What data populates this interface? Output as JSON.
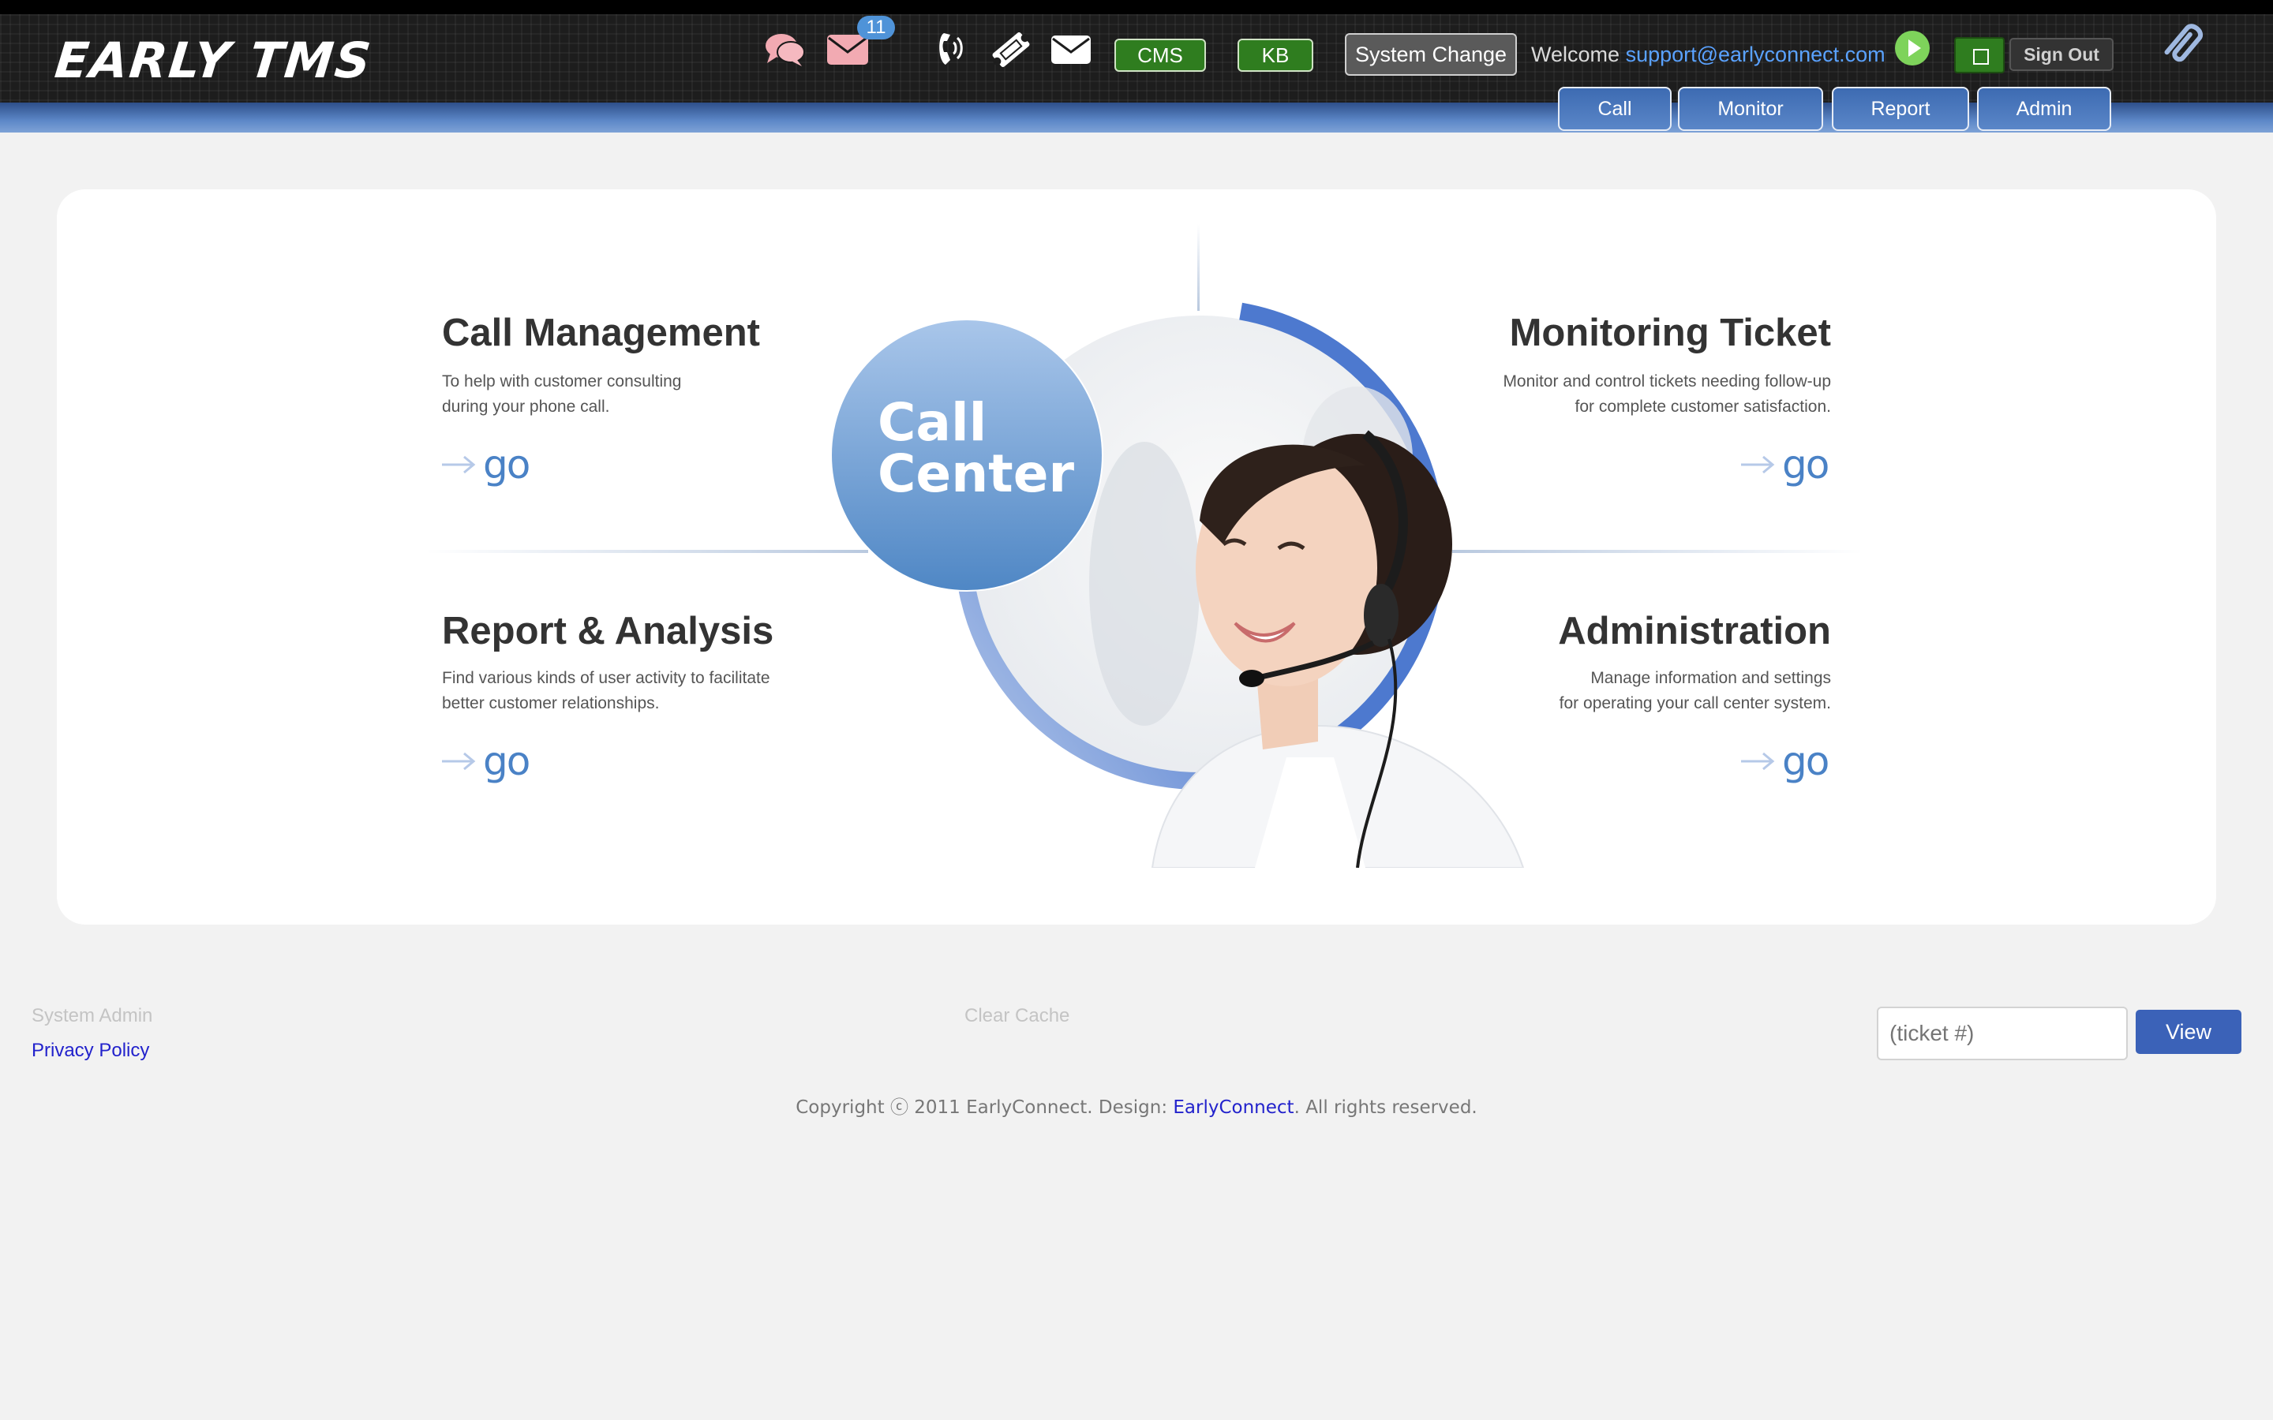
{
  "header": {
    "logo_text": "EARLY TMS",
    "icons": [
      "chat-icon",
      "mail-icon",
      "phone-icon",
      "ticket-icon",
      "envelope-icon"
    ],
    "mail_badge": "11",
    "cms_label": "CMS",
    "kb_label": "KB",
    "system_change_label": "System Change",
    "welcome_text": "Welcome",
    "user_email": "support@earlyconnect.com",
    "sign_out_label": "Sign Out",
    "nav": [
      "Call",
      "Monitor",
      "Report",
      "Admin"
    ]
  },
  "main": {
    "hero_bubble_line1": "Call",
    "hero_bubble_line2": "Center",
    "quadrants": [
      {
        "title": "Call Management",
        "desc_line1": "To help with customer consulting",
        "desc_line2": "during your phone call.",
        "go": "go"
      },
      {
        "title": "Monitoring Ticket",
        "desc_line1": "Monitor and control tickets needing follow-up",
        "desc_line2": "for complete customer satisfaction.",
        "go": "go"
      },
      {
        "title": "Report & Analysis",
        "desc_line1": "Find various kinds of user activity to facilitate",
        "desc_line2": "better customer relationships.",
        "go": "go"
      },
      {
        "title": "Administration",
        "desc_line1": "Manage information and settings",
        "desc_line2": "for operating your call center system.",
        "go": "go"
      }
    ]
  },
  "footer": {
    "system_admin": "System Admin",
    "privacy_policy": "Privacy Policy",
    "clear_cache": "Clear Cache",
    "ticket_placeholder": "(ticket #)",
    "view_label": "View",
    "copyright_prefix": "Copyright ⓒ 2011 EarlyConnect. Design: ",
    "copyright_link": "EarlyConnect",
    "copyright_suffix": ". All rights reserved."
  },
  "colors": {
    "accent_blue": "#4a82c6",
    "green_button": "#2f7d1f",
    "view_button": "#3b62b8",
    "email_link": "#5aa2ff"
  }
}
